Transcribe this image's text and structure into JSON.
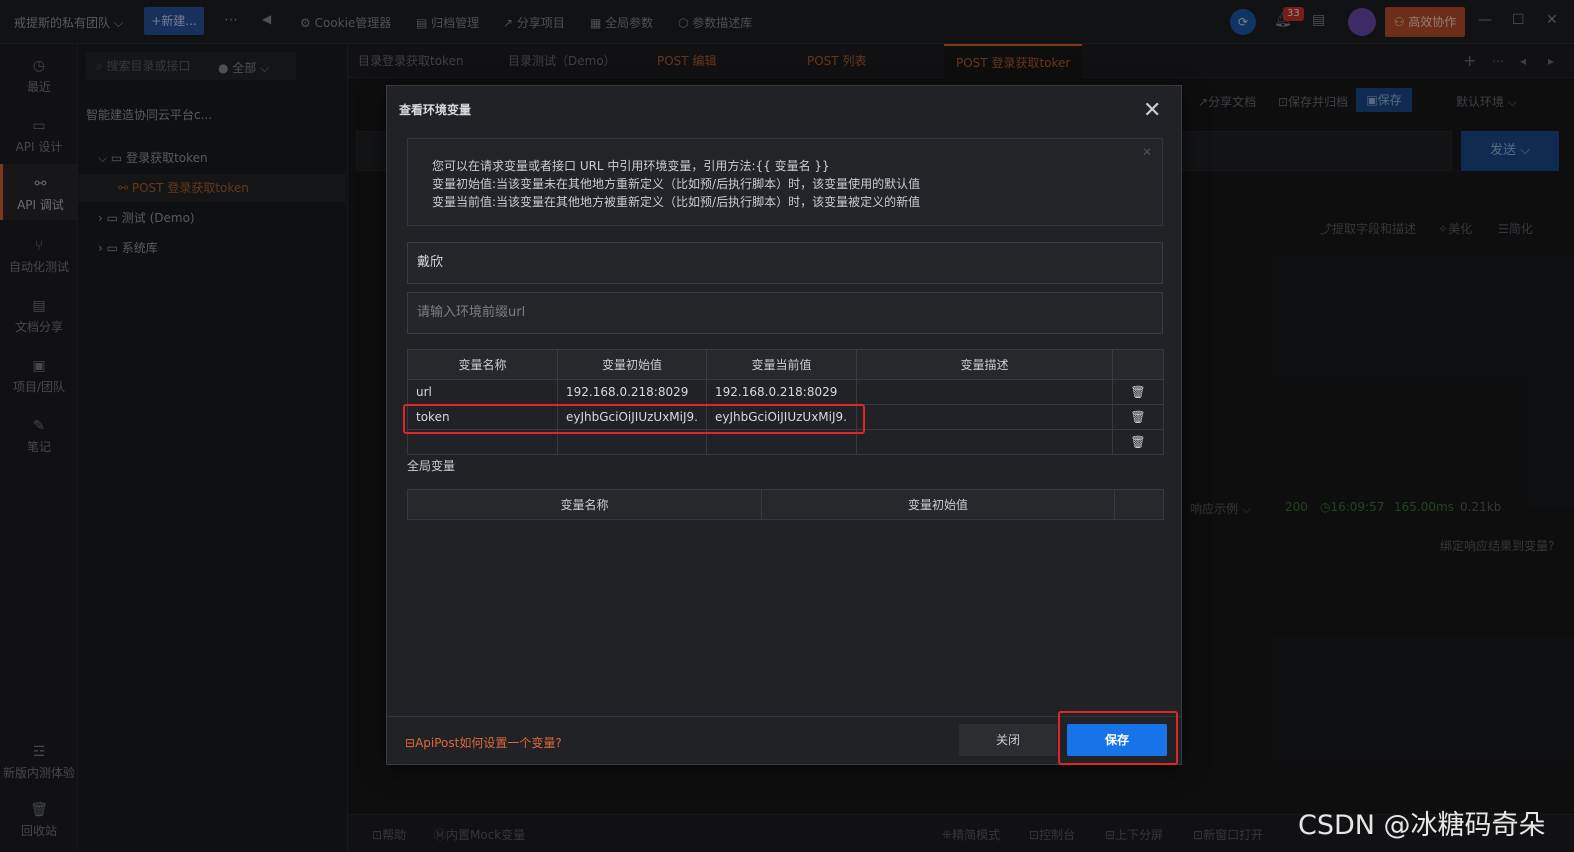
{
  "topbar": {
    "team": "戒提斯的私有团队 ⌵",
    "new_btn": "+新建...",
    "items": [
      "Cookie管理器",
      "归档管理",
      "分享项目",
      "全局参数",
      "参数描述库"
    ],
    "notif_count": "33",
    "collab": "高效协作"
  },
  "rail": {
    "items": [
      {
        "label": "最近",
        "icon": "clock-icon"
      },
      {
        "label": "API 设计",
        "icon": "design-icon"
      },
      {
        "label": "API 调试",
        "icon": "link-icon"
      },
      {
        "label": "自动化测试",
        "icon": "flow-icon"
      },
      {
        "label": "文档分享",
        "icon": "doc-icon"
      },
      {
        "label": "项目/团队",
        "icon": "team-icon"
      },
      {
        "label": "笔记",
        "icon": "note-icon"
      }
    ],
    "bottom": [
      "新版内测体验",
      "回收站"
    ]
  },
  "tree": {
    "search_placeholder": "搜索目录或接口",
    "filter": "全部",
    "project": "智能建造协同云平台c...",
    "rows": [
      "登录获取token",
      "POST 登录获取token",
      "测试 (Demo)",
      "系统库"
    ]
  },
  "tabs": [
    "目录登录获取token",
    "目录测试（Demo）",
    "POST 编辑",
    "POST 列表",
    "POST 登录获取toker"
  ],
  "toolbar": {
    "share_doc": "分享文档",
    "save_archive": "保存并归档",
    "save": "保存",
    "env": "默认环境",
    "send": "发送",
    "extract": "提取字段和描述",
    "beautify": "美化",
    "simplify": "简化"
  },
  "response": {
    "example": "响应示例",
    "status": "200",
    "time": "16:09:57",
    "duration": "165.00ms",
    "size": "0.21kb",
    "bind": "绑定响应结果到变量?"
  },
  "bottombar": [
    "帮助",
    "内置Mock变量",
    "精简模式",
    "控制台",
    "上下分屏",
    "新窗口打开"
  ],
  "modal": {
    "title": "查看环境变量",
    "info_lines": [
      "您可以在请求变量或者接口 URL 中引用环境变量，引用方法:{{ 变量名 }}",
      "变量初始值:当该变量未在其他地方重新定义（比如预/后执行脚本）时，该变量使用的默认值",
      "变量当前值:当该变量在其他地方被重新定义（比如预/后执行脚本）时，该变量被定义的新值"
    ],
    "env_name": "戴欣",
    "url_placeholder": "请输入环境前缀url",
    "env_headers": [
      "变量名称",
      "变量初始值",
      "变量当前值",
      "变量描述"
    ],
    "env_rows": [
      [
        "url",
        "192.168.0.218:8029",
        "192.168.0.218:8029",
        ""
      ],
      [
        "token",
        "eyJhbGciOiJIUzUxMiJ9.",
        "eyJhbGciOiJIUzUxMiJ9.",
        ""
      ],
      [
        "",
        "",
        "",
        ""
      ]
    ],
    "global_label": "全局变量",
    "global_headers": [
      "变量名称",
      "变量初始值"
    ],
    "help_link": "ApiPost如何设置一个变量?",
    "close_btn": "关闭",
    "save_btn": "保存"
  },
  "watermark": "CSDN @冰糖码奇朵"
}
